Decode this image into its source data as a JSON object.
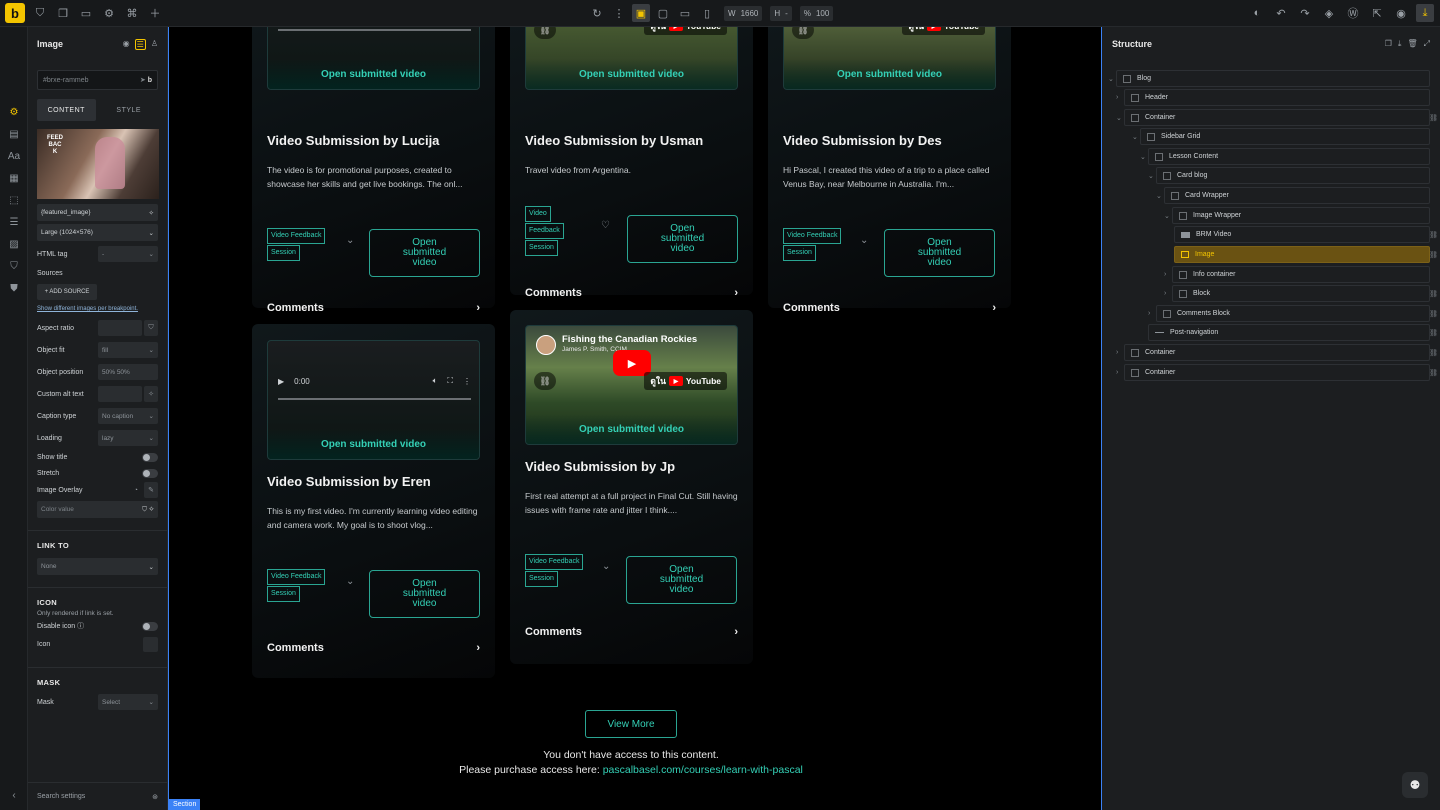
{
  "topbar": {
    "logo": "b",
    "width_label": "W",
    "width_value": "1660",
    "height_label": "H",
    "height_value": "-",
    "zoom_label": "%",
    "zoom_value": "100"
  },
  "panel": {
    "title": "Image",
    "element_id": "#brxe-rammeb",
    "tab_content": "CONTENT",
    "tab_style": "STYLE",
    "thumb_text": "FEEDBACK",
    "image_field": "{featured_image}",
    "size_select": "Large (1024×576)",
    "html_tag_label": "HTML tag",
    "html_tag_value": "-",
    "sources_label": "Sources",
    "add_source": "+ ADD SOURCE",
    "show_diff": "Show different images per breakpoint.",
    "aspect_ratio": "Aspect ratio",
    "object_fit": "Object fit",
    "object_fit_value": "fill",
    "object_position": "Object position",
    "object_position_value": "50% 50%",
    "custom_alt": "Custom alt text",
    "caption_type": "Caption type",
    "caption_type_value": "No caption",
    "loading": "Loading",
    "loading_value": "lazy",
    "show_title": "Show title",
    "stretch": "Stretch",
    "image_overlay": "Image Overlay",
    "color_value": "Color value",
    "link_to": "LINK TO",
    "link_to_value": "None",
    "icon_section": "ICON",
    "icon_note": "Only rendered if link is set.",
    "disable_icon": "Disable icon",
    "icon_label": "Icon",
    "mask_section": "MASK",
    "mask_label": "Mask",
    "mask_value": "Select",
    "search_settings": "Search settings"
  },
  "canvas": {
    "open_submitted": "Open submitted video",
    "open_btn": "Open submitted video",
    "tag_line1": "Video Feedback",
    "tag_line2": "Session",
    "tag_v1": "Video",
    "tag_v2": "Feedback",
    "tag_v3": "Session",
    "comments": "Comments",
    "player_time": "0:00",
    "cards": [
      {
        "title": "Video Submission by Lucija",
        "desc": "The video is for promotional purposes, created to showcase her skills and get live bookings. The onl..."
      },
      {
        "title": "Video Submission by Usman",
        "desc": "Travel video from Argentina."
      },
      {
        "title": "Video Submission by Des",
        "desc": "Hi Pascal, I created this video of a trip to a place called Venus Bay, near Melbourne in Australia. I'm..."
      },
      {
        "title": "Video Submission by Eren",
        "desc": "This is my first video. I'm currently learning video editing and camera work. My goal is to shoot vlog..."
      },
      {
        "title": "Video Submission by Jp",
        "desc": "First real attempt at a full project in Final Cut. Still having issues with frame rate and jitter I think...."
      }
    ],
    "yt_title": "Fishing the Canadian Rockies",
    "yt_sub": "James P. Smith, CCIM",
    "yt_logo": "YouTube",
    "yt_prefix": "ดูใน",
    "view_more": "View More",
    "no_access": "You don't have access to this content.",
    "purchase": "Please purchase access here: ",
    "purchase_link": "pascalbasel.com/courses/learn-with-pascal",
    "section_tag": "Section"
  },
  "structure": {
    "title": "Structure",
    "items": [
      {
        "label": "Blog"
      },
      {
        "label": "Header"
      },
      {
        "label": "Container"
      },
      {
        "label": "Sidebar Grid"
      },
      {
        "label": "Lesson Content"
      },
      {
        "label": "Card blog"
      },
      {
        "label": "Card Wrapper"
      },
      {
        "label": "Image Wrapper"
      },
      {
        "label": "BRM Video"
      },
      {
        "label": "Image"
      },
      {
        "label": "Info container"
      },
      {
        "label": "Block"
      },
      {
        "label": "Comments Block"
      },
      {
        "label": "Post-navigation"
      },
      {
        "label": "Container"
      },
      {
        "label": "Container"
      }
    ]
  }
}
